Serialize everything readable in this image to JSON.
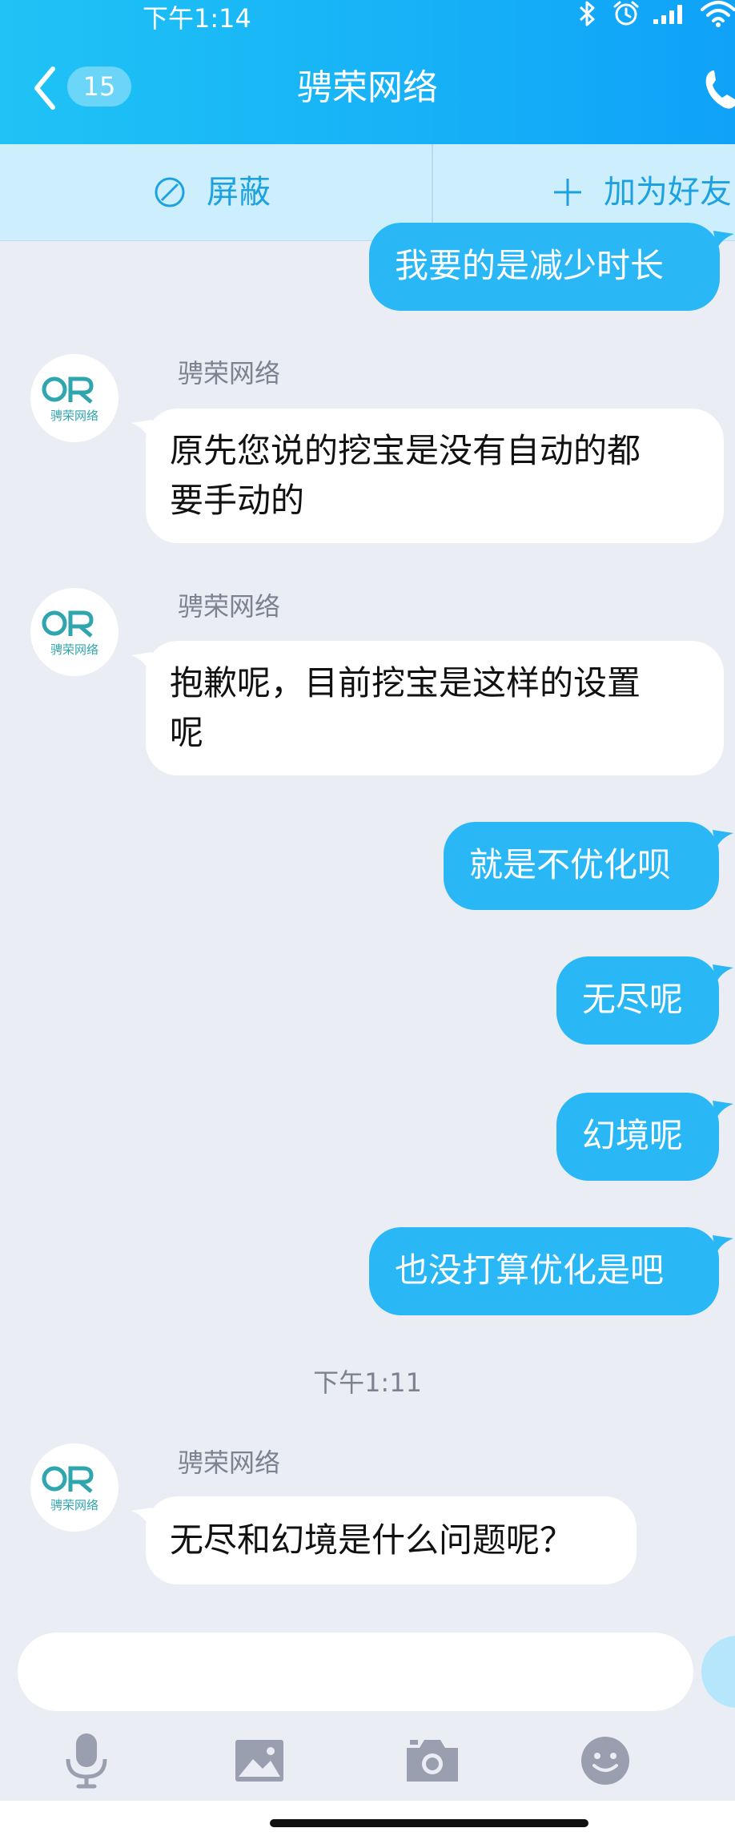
{
  "status_bar": {
    "time": "下午1:14"
  },
  "header": {
    "unread_count": "15",
    "title": "骋荣网络",
    "background_color": "#17b2f7"
  },
  "action_bar": {
    "block_label": "屏蔽",
    "add_friend_label": "加为好友"
  },
  "messages": [
    {
      "direction": "out",
      "lines": [
        "我要的是减少时长"
      ]
    },
    {
      "direction": "in",
      "sender": "骋荣网络",
      "lines": [
        "原先您说的挖宝是没有自动的都",
        "要手动的"
      ]
    },
    {
      "direction": "in",
      "sender": "骋荣网络",
      "lines": [
        "抱歉呢，目前挖宝是这样的设置",
        "呢"
      ]
    },
    {
      "direction": "out",
      "lines": [
        "就是不优化呗"
      ]
    },
    {
      "direction": "out",
      "lines": [
        "无尽呢"
      ]
    },
    {
      "direction": "out",
      "lines": [
        "幻境呢"
      ]
    },
    {
      "direction": "out",
      "lines": [
        "也没打算优化是吧"
      ]
    },
    {
      "direction": "in",
      "sender": "骋荣网络",
      "lines": [
        "无尽和幻境是什么问题呢？"
      ]
    }
  ],
  "timestamp_divider": "下午1:11",
  "avatar": {
    "logo_letters": "CR",
    "logo_caption": "骋荣网络"
  },
  "input": {
    "placeholder": "",
    "value": ""
  },
  "toolbar": {
    "icons": [
      "microphone-icon",
      "image-icon",
      "camera-icon",
      "emoji-icon"
    ]
  },
  "colors": {
    "outgoing_bubble": "#2ab7f6",
    "incoming_bubble": "#ffffff",
    "chat_background": "#ebedf5",
    "action_bar": "#cdeffd",
    "accent_text": "#1ea2df"
  }
}
